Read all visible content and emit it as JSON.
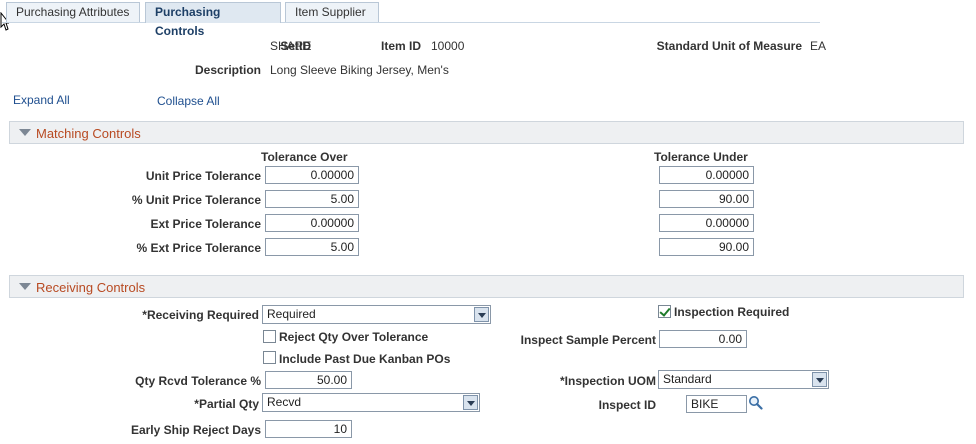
{
  "tabs": [
    {
      "label": "Purchasing Attributes"
    },
    {
      "label": "Purchasing Controls"
    },
    {
      "label": "Item Supplier"
    }
  ],
  "header": {
    "setid_label": "SetID",
    "setid_value": "SHARE",
    "itemid_label": "Item ID",
    "itemid_value": "10000",
    "uom_label": "Standard Unit of Measure",
    "uom_value": "EA",
    "desc_label": "Description",
    "desc_value": "Long Sleeve Biking Jersey, Men's"
  },
  "actions": {
    "expand_all": "Expand All",
    "collapse_all": "Collapse All"
  },
  "matching": {
    "title": "Matching Controls",
    "col_over": "Tolerance Over",
    "col_under": "Tolerance Under",
    "rows": [
      {
        "label": "Unit Price Tolerance",
        "over": "0.00000",
        "under": "0.00000"
      },
      {
        "label": "% Unit Price Tolerance",
        "over": "5.00",
        "under": "90.00"
      },
      {
        "label": "Ext Price Tolerance",
        "over": "0.00000",
        "under": "0.00000"
      },
      {
        "label": "% Ext Price Tolerance",
        "over": "5.00",
        "under": "90.00"
      }
    ]
  },
  "receiving": {
    "title": "Receiving Controls",
    "receiving_required_label": "*Receiving Required",
    "receiving_required_value": "Required",
    "inspection_required_label": "Inspection Required",
    "inspection_required_checked": true,
    "reject_qty_label": "Reject Qty Over Tolerance",
    "reject_qty_checked": false,
    "include_past_due_label": "Include Past Due Kanban POs",
    "include_past_due_checked": false,
    "inspect_sample_label": "Inspect Sample Percent",
    "inspect_sample_value": "0.00",
    "qty_rcvd_label": "Qty Rcvd Tolerance %",
    "qty_rcvd_value": "50.00",
    "inspection_uom_label": "*Inspection UOM",
    "inspection_uom_value": "Standard",
    "partial_qty_label": "*Partial Qty",
    "partial_qty_value": "Recvd",
    "inspect_id_label": "Inspect ID",
    "inspect_id_value": "BIKE",
    "early_ship_label": "Early Ship Reject Days",
    "early_ship_value": "10"
  }
}
